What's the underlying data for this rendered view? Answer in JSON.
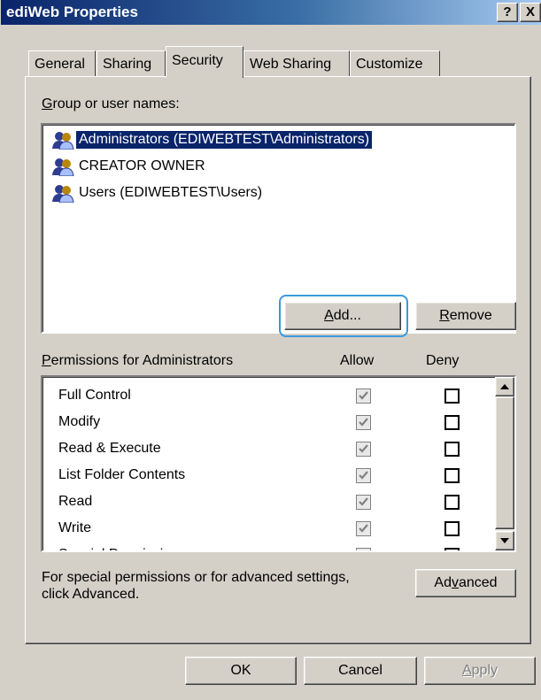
{
  "window": {
    "title": "ediWeb Properties",
    "help_label": "?",
    "close_label": "X"
  },
  "tabs": [
    {
      "label": "General"
    },
    {
      "label": "Sharing"
    },
    {
      "label": "Security"
    },
    {
      "label": "Web Sharing"
    },
    {
      "label": "Customize"
    }
  ],
  "active_tab": "Security",
  "users": {
    "label": "Group or user names:",
    "items": [
      {
        "label": "Administrators (EDIWEBTEST\\Administrators)",
        "selected": true
      },
      {
        "label": "CREATOR OWNER",
        "selected": false
      },
      {
        "label": "Users (EDIWEBTEST\\Users)",
        "selected": false
      }
    ]
  },
  "buttons": {
    "add": "Add...",
    "remove": "Remove",
    "advanced": "Advanced",
    "ok": "OK",
    "cancel": "Cancel",
    "apply": "Apply"
  },
  "permissions": {
    "label": "Permissions for Administrators",
    "allow_header": "Allow",
    "deny_header": "Deny",
    "rows": [
      {
        "name": "Full Control",
        "allow": true,
        "deny": false
      },
      {
        "name": "Modify",
        "allow": true,
        "deny": false
      },
      {
        "name": "Read & Execute",
        "allow": true,
        "deny": false
      },
      {
        "name": "List Folder Contents",
        "allow": true,
        "deny": false
      },
      {
        "name": "Read",
        "allow": true,
        "deny": false
      },
      {
        "name": "Write",
        "allow": true,
        "deny": false
      },
      {
        "name": "Special Permissions",
        "allow": false,
        "deny": false
      }
    ]
  },
  "advanced_note": {
    "line1": "For special permissions or for advanced settings,",
    "line2": "click Advanced."
  },
  "colors": {
    "title_bar": "#0a246a",
    "dialog_face": "#d4d0c8",
    "selection": "#0a246a",
    "focus_ring": "#3a9ad9"
  },
  "icons": {
    "user_group": "users-group-icon",
    "scroll_up": "scroll-up-arrow-icon",
    "scroll_down": "scroll-down-arrow-icon",
    "check": "checkmark-icon"
  }
}
